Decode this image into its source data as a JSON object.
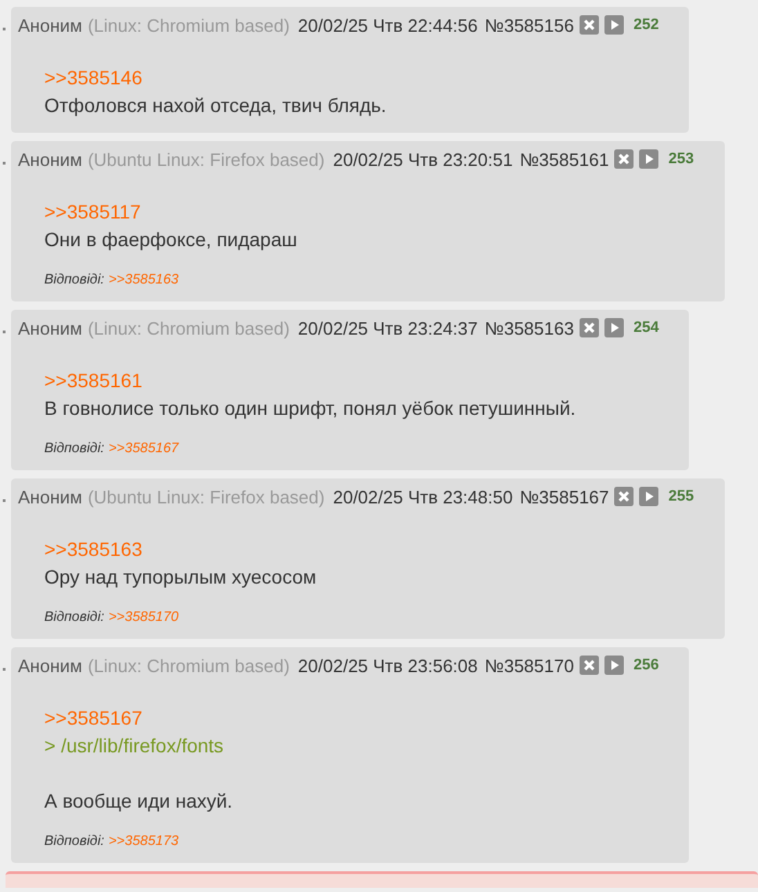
{
  "posts": [
    {
      "author": "Аноним",
      "client": "(Linux: Chromium based)",
      "datetime": "20/02/25 Чтв 22:44:56",
      "number": "№3585156",
      "index": "252",
      "paragraphs": [
        [
          {
            "kind": "reply",
            "text": ">>3585146"
          },
          {
            "kind": "text",
            "text": "Отфоловся нахой отседа, твич блядь."
          }
        ]
      ]
    },
    {
      "author": "Аноним",
      "client": "(Ubuntu Linux: Firefox based)",
      "datetime": "20/02/25 Чтв 23:20:51",
      "number": "№3585161",
      "index": "253",
      "paragraphs": [
        [
          {
            "kind": "reply",
            "text": ">>3585117"
          },
          {
            "kind": "text",
            "text": "Они в фаерфоксе, пидараш"
          }
        ]
      ],
      "replies_label": "Відповіді:",
      "replies": [
        ">>3585163"
      ]
    },
    {
      "author": "Аноним",
      "client": "(Linux: Chromium based)",
      "datetime": "20/02/25 Чтв 23:24:37",
      "number": "№3585163",
      "index": "254",
      "paragraphs": [
        [
          {
            "kind": "reply",
            "text": ">>3585161"
          },
          {
            "kind": "text",
            "text": "В говнолисе только один шрифт, понял уёбок петушинный."
          }
        ]
      ],
      "replies_label": "Відповіді:",
      "replies": [
        ">>3585167"
      ]
    },
    {
      "author": "Аноним",
      "client": "(Ubuntu Linux: Firefox based)",
      "datetime": "20/02/25 Чтв 23:48:50",
      "number": "№3585167",
      "index": "255",
      "paragraphs": [
        [
          {
            "kind": "reply",
            "text": ">>3585163"
          },
          {
            "kind": "text",
            "text": "Ору над тупорылым хуесосом"
          }
        ]
      ],
      "replies_label": "Відповіді:",
      "replies": [
        ">>3585170"
      ]
    },
    {
      "author": "Аноним",
      "client": "(Linux: Chromium based)",
      "datetime": "20/02/25 Чтв 23:56:08",
      "number": "№3585170",
      "index": "256",
      "paragraphs": [
        [
          {
            "kind": "reply",
            "text": ">>3585167"
          },
          {
            "kind": "quote",
            "text": "> /usr/lib/firefox/fonts"
          }
        ],
        [
          {
            "kind": "text",
            "text": "А вообще иди нахуй."
          }
        ]
      ],
      "replies_label": "Відповіді:",
      "replies": [
        ">>3585173"
      ]
    }
  ]
}
